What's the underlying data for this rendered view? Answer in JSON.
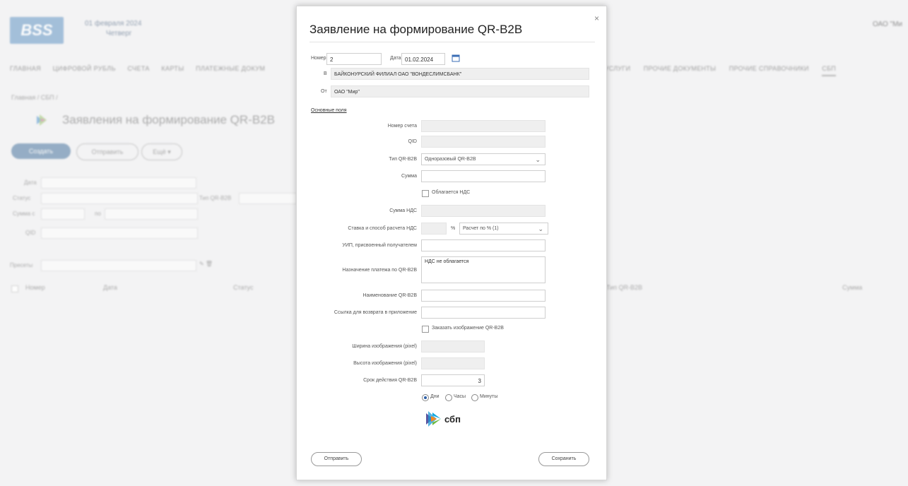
{
  "bg": {
    "logo": "BSS",
    "date_line1": "01 февраля 2024",
    "date_line2": "Четверг",
    "org_name": "ОАО \"Ми",
    "nav_left": [
      "ГЛАВНАЯ",
      "ЦИФРОВОЙ РУБЛЬ",
      "СЧЕТА",
      "КАРТЫ",
      "ПЛАТЕЖНЫЕ ДОКУМ"
    ],
    "nav_right": [
      "И УСЛУГИ",
      "ПРОЧИЕ ДОКУМЕНТЫ",
      "ПРОЧИЕ СПРАВОЧНИКИ",
      "СБП"
    ],
    "page_title": "Заявления на формирование QR-B2B",
    "col_headers": [
      "Номер",
      "Дата",
      "Статус",
      "Тип QR-B2B",
      "Сумма"
    ]
  },
  "modal": {
    "title": "Заявление на формирование QR-B2B",
    "close": "×",
    "number_label": "Номер",
    "number_value": "2",
    "date_label": "Дата",
    "date_value": "01.02.2024",
    "bank_prefix": "В",
    "bank_value": "БАЙКОНУРСКИЙ ФИЛИАЛ ОАО \"ВОНДЕСЛИМСБАНК\"",
    "from_prefix": "От",
    "from_value": "ОАО \"Мир\"",
    "section_link": "Основные поля",
    "fields": {
      "account_label": "Номер счета",
      "qr_type_label": "Тип QR-B2B",
      "qr_type_value": "Одноразовый QR-B2B",
      "amount_label": "Сумма",
      "vat_check_label": "Облагается НДС",
      "vat_amount_label": "Сумма НДС",
      "vat_rate_label": "Ставка и способ расчета НДС",
      "vat_pct": "%",
      "vat_method_value": "Расчет по % (1)",
      "uin_label": "УИП, присвоенный получателем",
      "purpose_label": "Назначение платежа по QR-B2B",
      "purpose_value": "НДС не облагается",
      "name_label": "Наименование QR-B2B",
      "link_label": "Ссылка для возврата в приложение",
      "image_check_label": "Заказать изображение QR-B2B",
      "width_label": "Ширина изображения (pixel)",
      "height_label": "Высота изображения (pixel)",
      "validity_label": "Срок действия QR-B2B",
      "validity_value": "3"
    },
    "radios": [
      "Дни",
      "Часы",
      "Минуты"
    ],
    "sbp_logo_text": "сбп",
    "btn_send": "Отправить",
    "btn_save": "Сохранить"
  }
}
